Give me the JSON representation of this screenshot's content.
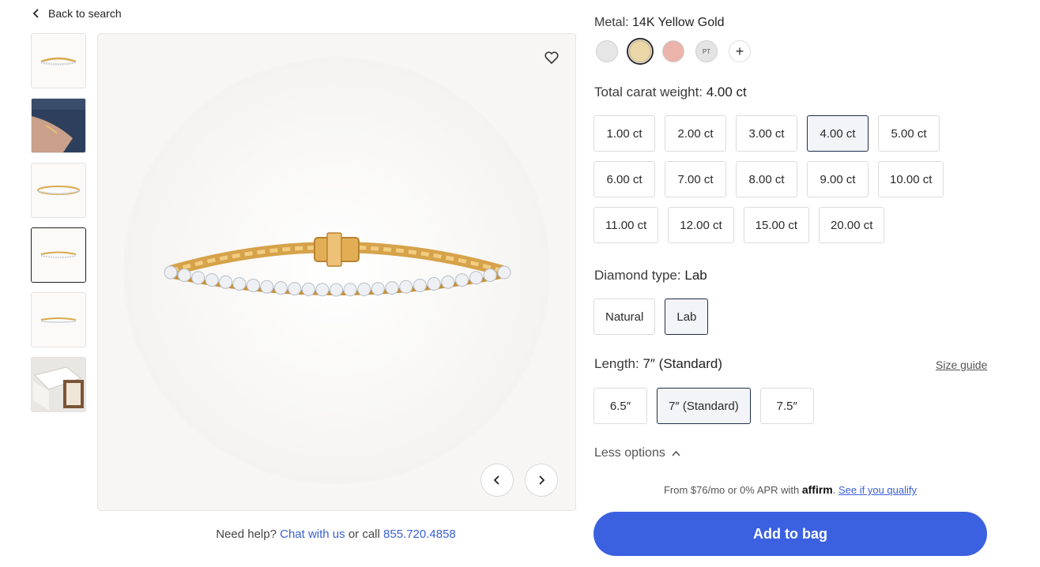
{
  "nav": {
    "back_label": "Back to search"
  },
  "gallery": {
    "thumbnails": [
      "bracelet-front",
      "bracelet-on-wrist",
      "bracelet-angle",
      "bracelet-front-selected",
      "bracelet-flat",
      "bracelet-in-box"
    ],
    "selected_index": 3
  },
  "help": {
    "prefix": "Need help?",
    "chat_link": "Chat with us",
    "middle": "or call",
    "phone": "855.720.4858"
  },
  "metal": {
    "label": "Metal:",
    "value": "14K Yellow Gold",
    "swatches": [
      {
        "name": "white-gold",
        "color": "#e6e6e6"
      },
      {
        "name": "yellow-gold",
        "color": "#ead7a8"
      },
      {
        "name": "rose-gold",
        "color": "#eab4aa"
      },
      {
        "name": "platinum",
        "color": "#e4e4e4",
        "text": "PT"
      }
    ],
    "more": "+"
  },
  "carat": {
    "label": "Total carat weight:",
    "value": "4.00 ct",
    "options": [
      "1.00 ct",
      "2.00 ct",
      "3.00 ct",
      "4.00 ct",
      "5.00 ct",
      "6.00 ct",
      "7.00 ct",
      "8.00 ct",
      "9.00 ct",
      "10.00 ct",
      "11.00 ct",
      "12.00 ct",
      "15.00 ct",
      "20.00 ct"
    ],
    "selected": "4.00 ct"
  },
  "diamond": {
    "label": "Diamond type:",
    "value": "Lab",
    "options": [
      "Natural",
      "Lab"
    ],
    "selected": "Lab"
  },
  "length": {
    "label": "Length:",
    "value": "7″ (Standard)",
    "options": [
      "6.5″",
      "7″ (Standard)",
      "7.5″"
    ],
    "selected": "7″ (Standard)",
    "size_guide": "Size guide"
  },
  "less_options": "Less options",
  "finance": {
    "text": "From $76/mo or 0% APR with",
    "brand": "affirm",
    "link": "See if you qualify"
  },
  "cta": {
    "add_to_bag": "Add to bag"
  },
  "colors": {
    "accent": "#3b61e0",
    "link": "#3a5fd6",
    "gold": "#e0b560"
  }
}
